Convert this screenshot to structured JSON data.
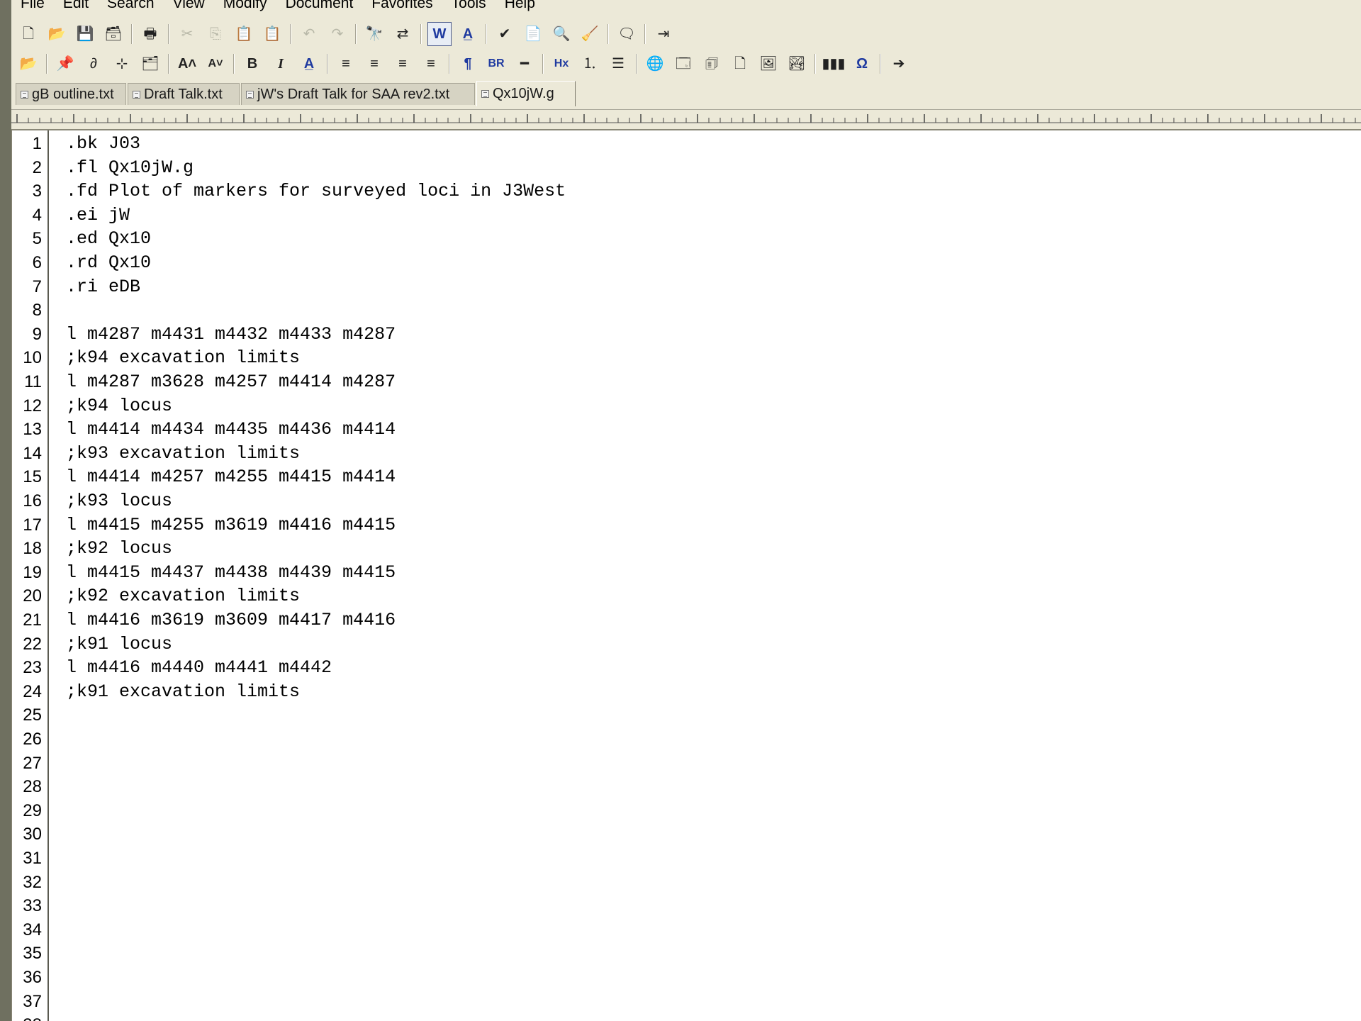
{
  "menu": [
    "File",
    "Edit",
    "Search",
    "View",
    "Modify",
    "Document",
    "Favorites",
    "Tools",
    "Help"
  ],
  "toolbar1": [
    {
      "icon": "new-document-icon",
      "glyph": "🗋"
    },
    {
      "icon": "open-folder-icon",
      "glyph": "📂"
    },
    {
      "icon": "save-icon",
      "glyph": "💾",
      "disabled": true
    },
    {
      "icon": "save-all-icon",
      "glyph": "🗃"
    },
    {
      "sep": true
    },
    {
      "icon": "print-icon",
      "glyph": "🖶"
    },
    {
      "sep": true
    },
    {
      "icon": "cut-icon",
      "glyph": "✂",
      "disabled": true
    },
    {
      "icon": "copy-icon",
      "glyph": "⎘",
      "disabled": true
    },
    {
      "icon": "paste-icon",
      "glyph": "📋",
      "disabled": true
    },
    {
      "icon": "paste-special-icon",
      "glyph": "📋",
      "disabled": true
    },
    {
      "sep": true
    },
    {
      "icon": "undo-icon",
      "glyph": "↶",
      "disabled": true
    },
    {
      "icon": "redo-icon",
      "glyph": "↷",
      "disabled": true
    },
    {
      "sep": true
    },
    {
      "icon": "find-icon",
      "glyph": "🔭"
    },
    {
      "icon": "replace-icon",
      "glyph": "⇄"
    },
    {
      "sep": true
    },
    {
      "icon": "word-wrap-icon",
      "glyph": "W",
      "pressed": true,
      "style": "blue"
    },
    {
      "icon": "font-icon",
      "glyph": "A̲",
      "style": "blue"
    },
    {
      "sep": true
    },
    {
      "icon": "spell-check-icon",
      "glyph": "✔"
    },
    {
      "icon": "clipboard-icon",
      "glyph": "📄"
    },
    {
      "icon": "preview-icon",
      "glyph": "🔍"
    },
    {
      "icon": "tools-icon",
      "glyph": "🧹"
    },
    {
      "sep": true
    },
    {
      "icon": "insert-icon",
      "glyph": "🗨"
    },
    {
      "sep": true
    },
    {
      "icon": "exit-icon",
      "glyph": "⇥"
    }
  ],
  "toolbar2": [
    {
      "icon": "open-project-icon",
      "glyph": "📂"
    },
    {
      "sep": true
    },
    {
      "icon": "pin-icon",
      "glyph": "📌"
    },
    {
      "icon": "link-icon",
      "glyph": "∂"
    },
    {
      "icon": "tree-icon",
      "glyph": "⊹"
    },
    {
      "icon": "folder-star-icon",
      "glyph": "🗂"
    },
    {
      "sep": true
    },
    {
      "icon": "increase-font-icon",
      "glyph": "A˄",
      "style": "bold"
    },
    {
      "icon": "decrease-font-icon",
      "glyph": "A˅",
      "style": "bold small"
    },
    {
      "sep": true
    },
    {
      "icon": "bold-icon",
      "glyph": "B",
      "style": "bold"
    },
    {
      "icon": "italic-icon",
      "glyph": "I",
      "style": "italic"
    },
    {
      "icon": "font-color-icon",
      "glyph": "A̲",
      "style": "blue"
    },
    {
      "sep": true
    },
    {
      "icon": "align-left-icon",
      "glyph": "≡"
    },
    {
      "icon": "align-center-icon",
      "glyph": "≡"
    },
    {
      "icon": "align-justify-icon",
      "glyph": "≡"
    },
    {
      "icon": "align-right-icon",
      "glyph": "≡"
    },
    {
      "sep": true
    },
    {
      "icon": "paragraph-icon",
      "glyph": "¶",
      "style": "blue"
    },
    {
      "icon": "line-break-icon",
      "glyph": "BR",
      "style": "blue small"
    },
    {
      "icon": "horizontal-rule-icon",
      "glyph": "━"
    },
    {
      "sep": true
    },
    {
      "icon": "heading-icon",
      "glyph": "Hx",
      "style": "blue small"
    },
    {
      "icon": "numbered-list-icon",
      "glyph": "⒈"
    },
    {
      "icon": "bullet-list-icon",
      "glyph": "☰"
    },
    {
      "sep": true
    },
    {
      "icon": "hyperlink-icon",
      "glyph": "🌐"
    },
    {
      "icon": "form-icon",
      "glyph": "🗔"
    },
    {
      "icon": "table-icon",
      "glyph": "🗊"
    },
    {
      "icon": "frame-icon",
      "glyph": "🗋"
    },
    {
      "icon": "image-map-icon",
      "glyph": "🖼"
    },
    {
      "icon": "image-icon",
      "glyph": "🏞"
    },
    {
      "sep": true
    },
    {
      "icon": "color-bars-icon",
      "glyph": "▮▮▮"
    },
    {
      "icon": "omega-icon",
      "glyph": "Ω",
      "style": "blue"
    },
    {
      "sep": true
    },
    {
      "icon": "arrow-right-icon",
      "glyph": "➔"
    }
  ],
  "tabs": [
    {
      "label": "gB outline.txt",
      "active": false
    },
    {
      "label": "Draft Talk.txt",
      "active": false
    },
    {
      "label": "jW's Draft Talk for SAA rev2.txt",
      "active": false
    },
    {
      "label": "Qx10jW.g",
      "active": true
    }
  ],
  "lines": [
    ".bk J03",
    ".fl Qx10jW.g",
    ".fd Plot of markers for surveyed loci in J3West",
    ".ei jW",
    ".ed Qx10",
    ".rd Qx10",
    ".ri eDB",
    "",
    "l m4287 m4431 m4432 m4433 m4287",
    ";k94 excavation limits",
    "l m4287 m3628 m4257 m4414 m4287",
    ";k94 locus",
    "l m4414 m4434 m4435 m4436 m4414",
    ";k93 excavation limits",
    "l m4414 m4257 m4255 m4415 m4414",
    ";k93 locus",
    "l m4415 m4255 m3619 m4416 m4415",
    ";k92 locus",
    "l m4415 m4437 m4438 m4439 m4415",
    ";k92 excavation limits",
    "l m4416 m3619 m3609 m4417 m4416",
    ";k91 locus",
    "l m4416 m4440 m4441 m4442",
    ";k91 excavation limits",
    "",
    "",
    "",
    "",
    "",
    "",
    "",
    "",
    "",
    "",
    "",
    "",
    ""
  ],
  "line_count": 38,
  "colors": {
    "chrome": "#ece9d8",
    "editor_bg": "#ffffff",
    "text": "#000000",
    "gutter_border": "#5a5a50"
  }
}
